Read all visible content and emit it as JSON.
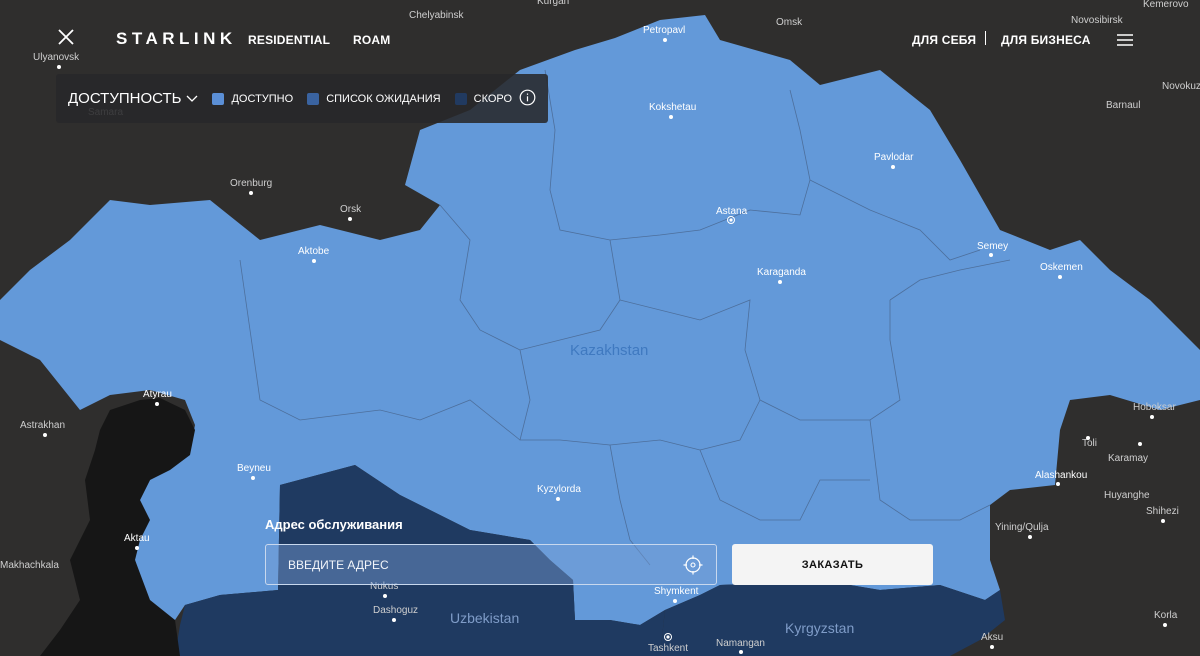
{
  "header": {
    "logo": "STARLINK",
    "nav_left": [
      "RESIDENTIAL",
      "ROAM"
    ],
    "nav_right": [
      "ДЛЯ СЕБЯ",
      "ДЛЯ БИЗНЕСА"
    ]
  },
  "legend": {
    "title": "ДОСТУПНОСТЬ",
    "items": [
      {
        "label": "ДОСТУПНО",
        "color": "#5b8fd6"
      },
      {
        "label": "СПИСОК ОЖИДАНИЯ",
        "color": "#3a63a0"
      },
      {
        "label": "СКОРО",
        "color": "#213a60"
      }
    ]
  },
  "colors": {
    "available": "#6399d9",
    "soon": "#1f3a61",
    "land": "#2f2e2d",
    "sea": "#161616"
  },
  "map": {
    "countries": [
      "Kazakhstan",
      "Uzbekistan",
      "Kyrgyzstan"
    ],
    "cities": [
      "Chelyabinsk",
      "Kurgan",
      "Omsk",
      "Novosibirsk",
      "Kemerovo",
      "Ulyanovsk",
      "Petropavl",
      "Kokshetau",
      "Barnaul",
      "Novokuz",
      "Samara",
      "Pavlodar",
      "Orenburg",
      "Orsk",
      "Astana",
      "Semey",
      "Oskemen",
      "Aktobe",
      "Karaganda",
      "Atyrau",
      "Astrakhan",
      "Hoboksar",
      "Beyneu",
      "Toli",
      "Karamay",
      "Kyzylorda",
      "Alashankou",
      "Huyanghe",
      "Aktau",
      "Shihezi",
      "Yining/Qulja",
      "Makhachkala",
      "Nukus",
      "Dashoguz",
      "Shymkent",
      "Tashkent",
      "Namangan",
      "Korla",
      "Aksu"
    ]
  },
  "address": {
    "label": "Адрес обслуживания",
    "placeholder": "ВВЕДИТЕ АДРЕС",
    "value": ""
  },
  "order_button": "ЗАКАЗАТЬ",
  "icons": {
    "close": "close-icon",
    "menu": "hamburger-menu-icon",
    "chevron": "chevron-down-icon",
    "info": "info-icon",
    "locate": "crosshair-locate-icon"
  }
}
